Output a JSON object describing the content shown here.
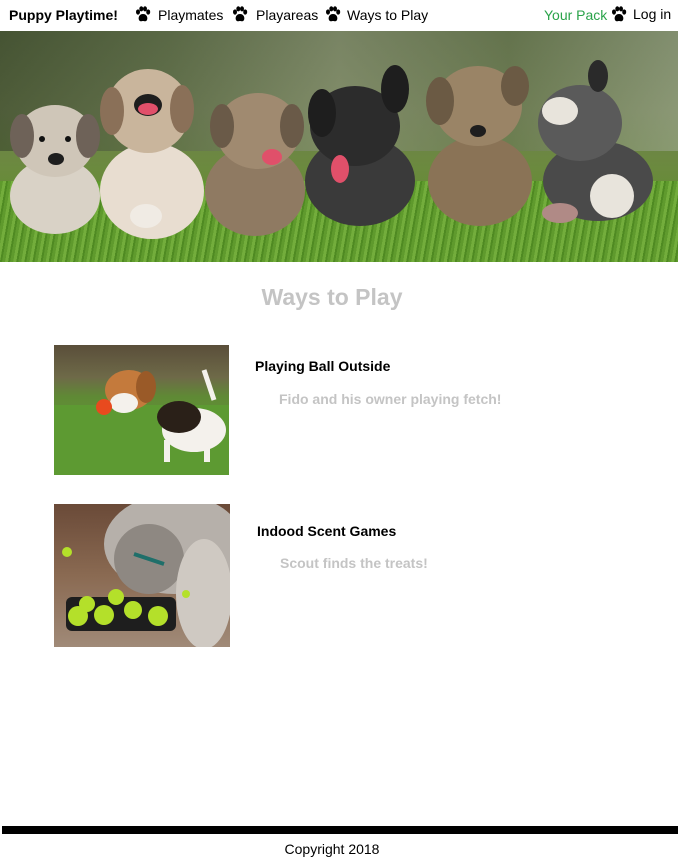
{
  "nav": {
    "brand": "Puppy Playtime!",
    "links": [
      "Playmates",
      "Playareas",
      "Ways to Play"
    ],
    "your_pack": "Your Pack",
    "login": "Log in",
    "accent_color": "#2aa34a"
  },
  "hero": {
    "image": "puppies-running-photo"
  },
  "main": {
    "title": "Ways to Play",
    "items": [
      {
        "title": "Playing Ball Outside",
        "caption": "Fido and his owner playing fetch!",
        "image": "beagle-puppy-ball-photo"
      },
      {
        "title": "Indood Scent Games",
        "caption": "Scout finds the treats!",
        "image": "dog-puzzle-toy-photo"
      }
    ]
  },
  "footer": {
    "copyright": "Copyright 2018"
  }
}
